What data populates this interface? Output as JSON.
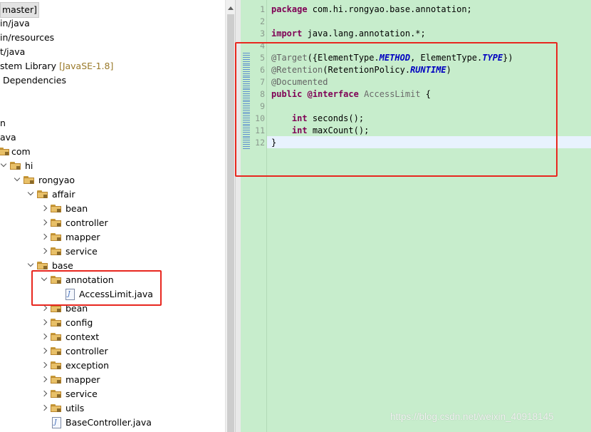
{
  "tree": {
    "rows": [
      {
        "text": "master]",
        "prefix": "",
        "type": "text",
        "selected": true
      },
      {
        "text": "in/java",
        "type": "text"
      },
      {
        "text": "in/resources",
        "type": "text"
      },
      {
        "text": "t/java",
        "type": "text"
      },
      {
        "text": "stem Library ",
        "deco": "[JavaSE-1.8]",
        "type": "text"
      },
      {
        "text": "Dependencies",
        "type": "text"
      },
      {
        "text": "",
        "type": "blank"
      },
      {
        "text": "",
        "type": "blank"
      },
      {
        "text": "n",
        "type": "text"
      },
      {
        "text": "ava",
        "type": "text"
      },
      {
        "text": "com",
        "type": "folder"
      },
      {
        "text": "hi",
        "type": "folder"
      },
      {
        "text": "rongyao",
        "type": "folder"
      },
      {
        "text": "affair",
        "type": "folder"
      },
      {
        "text": "bean",
        "type": "folder"
      },
      {
        "text": "controller",
        "type": "folder"
      },
      {
        "text": "mapper",
        "type": "folder"
      },
      {
        "text": "service",
        "type": "folder"
      },
      {
        "text": "base",
        "type": "folder"
      },
      {
        "text": "annotation",
        "type": "folder"
      },
      {
        "text": "AccessLimit.java",
        "type": "java"
      },
      {
        "text": "bean",
        "type": "folder"
      },
      {
        "text": "config",
        "type": "folder"
      },
      {
        "text": "context",
        "type": "folder"
      },
      {
        "text": "controller",
        "type": "folder"
      },
      {
        "text": "exception",
        "type": "folder"
      },
      {
        "text": "mapper",
        "type": "folder"
      },
      {
        "text": "service",
        "type": "folder"
      },
      {
        "text": "utils",
        "type": "folder"
      },
      {
        "text": "BaseController.java",
        "type": "java"
      }
    ]
  },
  "editor": {
    "line_numbers": [
      "1",
      "2",
      "3",
      "4",
      "5",
      "6",
      "7",
      "8",
      "9",
      "10",
      "11",
      "12"
    ],
    "lines": [
      [
        {
          "t": "package",
          "c": "kw"
        },
        {
          "t": " com.hi.rongyao.base.annotation;"
        }
      ],
      [],
      [
        {
          "t": "import",
          "c": "kw"
        },
        {
          "t": " java.lang.annotation.*;"
        }
      ],
      [],
      [
        {
          "t": "@Target",
          "c": "ann"
        },
        {
          "t": "({ElementType."
        },
        {
          "t": "METHOD",
          "c": "enum"
        },
        {
          "t": ", ElementType."
        },
        {
          "t": "TYPE",
          "c": "enum"
        },
        {
          "t": "})"
        }
      ],
      [
        {
          "t": "@Retention",
          "c": "ann"
        },
        {
          "t": "(RetentionPolicy."
        },
        {
          "t": "RUNTIME",
          "c": "enum"
        },
        {
          "t": ")"
        }
      ],
      [
        {
          "t": "@Documented",
          "c": "ann"
        }
      ],
      [
        {
          "t": "public",
          "c": "kw"
        },
        {
          "t": " "
        },
        {
          "t": "@interface",
          "c": "kw"
        },
        {
          "t": " "
        },
        {
          "t": "AccessLimit",
          "c": "iface"
        },
        {
          "t": " {"
        }
      ],
      [],
      [
        {
          "t": "    "
        },
        {
          "t": "int",
          "c": "kw"
        },
        {
          "t": " seconds();"
        }
      ],
      [
        {
          "t": "    "
        },
        {
          "t": "int",
          "c": "kw"
        },
        {
          "t": " maxCount();"
        }
      ],
      [
        {
          "t": "}"
        }
      ]
    ]
  },
  "watermark": "https://blog.csdn.net/weixin_40918145",
  "colors": {
    "editor_bg": "#c7edcc",
    "highlight_box": "#e8271f"
  }
}
